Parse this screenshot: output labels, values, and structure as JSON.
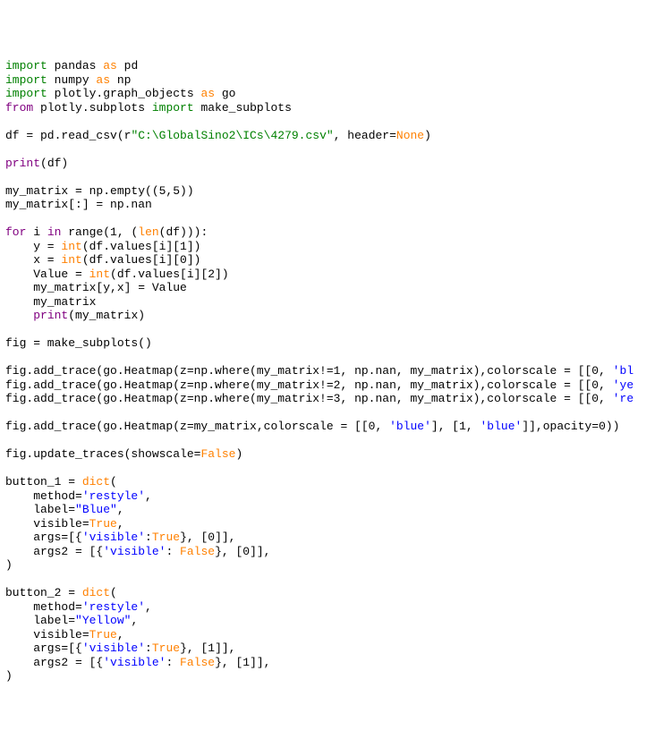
{
  "lines": [
    [
      {
        "t": "import",
        "c": "kw"
      },
      {
        "t": " pandas ",
        "c": "default"
      },
      {
        "t": "as",
        "c": "orange"
      },
      {
        "t": " pd",
        "c": "default"
      }
    ],
    [
      {
        "t": "import",
        "c": "kw"
      },
      {
        "t": " numpy ",
        "c": "default"
      },
      {
        "t": "as",
        "c": "orange"
      },
      {
        "t": " np",
        "c": "default"
      }
    ],
    [
      {
        "t": "import",
        "c": "kw"
      },
      {
        "t": " plotly.graph_objects ",
        "c": "default"
      },
      {
        "t": "as",
        "c": "orange"
      },
      {
        "t": " go",
        "c": "default"
      }
    ],
    [
      {
        "t": "from",
        "c": "purple"
      },
      {
        "t": " plotly.subplots ",
        "c": "default"
      },
      {
        "t": "import",
        "c": "kw"
      },
      {
        "t": " make_subplots",
        "c": "default"
      }
    ],
    [],
    [
      {
        "t": "df = pd.read_csv(",
        "c": "default"
      },
      {
        "t": "r",
        "c": "default"
      },
      {
        "t": "\"C:\\GlobalSino2\\ICs\\4279.csv\"",
        "c": "rawstr"
      },
      {
        "t": ", header=",
        "c": "default"
      },
      {
        "t": "None",
        "c": "orange"
      },
      {
        "t": ")",
        "c": "default"
      }
    ],
    [],
    [
      {
        "t": "print",
        "c": "purple"
      },
      {
        "t": "(df)",
        "c": "default"
      }
    ],
    [],
    [
      {
        "t": "my_matrix = np.empty((5,5))",
        "c": "default"
      }
    ],
    [
      {
        "t": "my_matrix[:] = np.nan",
        "c": "default"
      }
    ],
    [],
    [
      {
        "t": "for",
        "c": "purple"
      },
      {
        "t": " i ",
        "c": "default"
      },
      {
        "t": "in",
        "c": "purple"
      },
      {
        "t": " ",
        "c": "default"
      },
      {
        "t": "range",
        "c": "default"
      },
      {
        "t": "(1, (",
        "c": "default"
      },
      {
        "t": "len",
        "c": "orange"
      },
      {
        "t": "(df))):",
        "c": "default"
      }
    ],
    [
      {
        "t": "    y = ",
        "c": "default"
      },
      {
        "t": "int",
        "c": "orange"
      },
      {
        "t": "(df.values[i][1])",
        "c": "default"
      }
    ],
    [
      {
        "t": "    x = ",
        "c": "default"
      },
      {
        "t": "int",
        "c": "orange"
      },
      {
        "t": "(df.values[i][0])",
        "c": "default"
      }
    ],
    [
      {
        "t": "    Value = ",
        "c": "default"
      },
      {
        "t": "int",
        "c": "orange"
      },
      {
        "t": "(df.values[i][2])",
        "c": "default"
      }
    ],
    [
      {
        "t": "    my_matrix[y,x] = Value",
        "c": "default"
      }
    ],
    [
      {
        "t": "    my_matrix",
        "c": "default"
      }
    ],
    [
      {
        "t": "    ",
        "c": "default"
      },
      {
        "t": "print",
        "c": "purple"
      },
      {
        "t": "(my_matrix)",
        "c": "default"
      }
    ],
    [],
    [
      {
        "t": "fig = make_subplots()",
        "c": "default"
      }
    ],
    [],
    [
      {
        "t": "fig.add_trace(go.Heatmap(z=np.where(my_matrix!=1, np.nan, my_matrix),colorscale = [[0, ",
        "c": "default"
      },
      {
        "t": "'bl",
        "c": "str"
      }
    ],
    [
      {
        "t": "fig.add_trace(go.Heatmap(z=np.where(my_matrix!=2, np.nan, my_matrix),colorscale = [[0, ",
        "c": "default"
      },
      {
        "t": "'ye",
        "c": "str"
      }
    ],
    [
      {
        "t": "fig.add_trace(go.Heatmap(z=np.where(my_matrix!=3, np.nan, my_matrix),colorscale = [[0, ",
        "c": "default"
      },
      {
        "t": "'re",
        "c": "str"
      }
    ],
    [],
    [
      {
        "t": "fig.add_trace(go.Heatmap(z=my_matrix,colorscale = [[0, ",
        "c": "default"
      },
      {
        "t": "'blue'",
        "c": "str"
      },
      {
        "t": "], [1, ",
        "c": "default"
      },
      {
        "t": "'blue'",
        "c": "str"
      },
      {
        "t": "]],opacity=0))",
        "c": "default"
      }
    ],
    [],
    [
      {
        "t": "fig.update_traces(showscale=",
        "c": "default"
      },
      {
        "t": "False",
        "c": "orange"
      },
      {
        "t": ")",
        "c": "default"
      }
    ],
    [],
    [
      {
        "t": "button_1 = ",
        "c": "default"
      },
      {
        "t": "dict",
        "c": "orange"
      },
      {
        "t": "(",
        "c": "default"
      }
    ],
    [
      {
        "t": "    method=",
        "c": "default"
      },
      {
        "t": "'restyle'",
        "c": "str"
      },
      {
        "t": ",",
        "c": "default"
      }
    ],
    [
      {
        "t": "    label=",
        "c": "default"
      },
      {
        "t": "\"Blue\"",
        "c": "str"
      },
      {
        "t": ",",
        "c": "default"
      }
    ],
    [
      {
        "t": "    visible=",
        "c": "default"
      },
      {
        "t": "True",
        "c": "orange"
      },
      {
        "t": ",",
        "c": "default"
      }
    ],
    [
      {
        "t": "    args=[{",
        "c": "default"
      },
      {
        "t": "'visible'",
        "c": "str"
      },
      {
        "t": ":",
        "c": "default"
      },
      {
        "t": "True",
        "c": "orange"
      },
      {
        "t": "}, [0]],",
        "c": "default"
      }
    ],
    [
      {
        "t": "    args2 = [{",
        "c": "default"
      },
      {
        "t": "'visible'",
        "c": "str"
      },
      {
        "t": ": ",
        "c": "default"
      },
      {
        "t": "False",
        "c": "orange"
      },
      {
        "t": "}, [0]],",
        "c": "default"
      }
    ],
    [
      {
        "t": ")",
        "c": "default"
      }
    ],
    [],
    [
      {
        "t": "button_2 = ",
        "c": "default"
      },
      {
        "t": "dict",
        "c": "orange"
      },
      {
        "t": "(",
        "c": "default"
      }
    ],
    [
      {
        "t": "    method=",
        "c": "default"
      },
      {
        "t": "'restyle'",
        "c": "str"
      },
      {
        "t": ",",
        "c": "default"
      }
    ],
    [
      {
        "t": "    label=",
        "c": "default"
      },
      {
        "t": "\"Yellow\"",
        "c": "str"
      },
      {
        "t": ",",
        "c": "default"
      }
    ],
    [
      {
        "t": "    visible=",
        "c": "default"
      },
      {
        "t": "True",
        "c": "orange"
      },
      {
        "t": ",",
        "c": "default"
      }
    ],
    [
      {
        "t": "    args=[{",
        "c": "default"
      },
      {
        "t": "'visible'",
        "c": "str"
      },
      {
        "t": ":",
        "c": "default"
      },
      {
        "t": "True",
        "c": "orange"
      },
      {
        "t": "}, [1]],",
        "c": "default"
      }
    ],
    [
      {
        "t": "    args2 = [{",
        "c": "default"
      },
      {
        "t": "'visible'",
        "c": "str"
      },
      {
        "t": ": ",
        "c": "default"
      },
      {
        "t": "False",
        "c": "orange"
      },
      {
        "t": "}, [1]],",
        "c": "default"
      }
    ],
    [
      {
        "t": ")",
        "c": "default"
      }
    ]
  ]
}
